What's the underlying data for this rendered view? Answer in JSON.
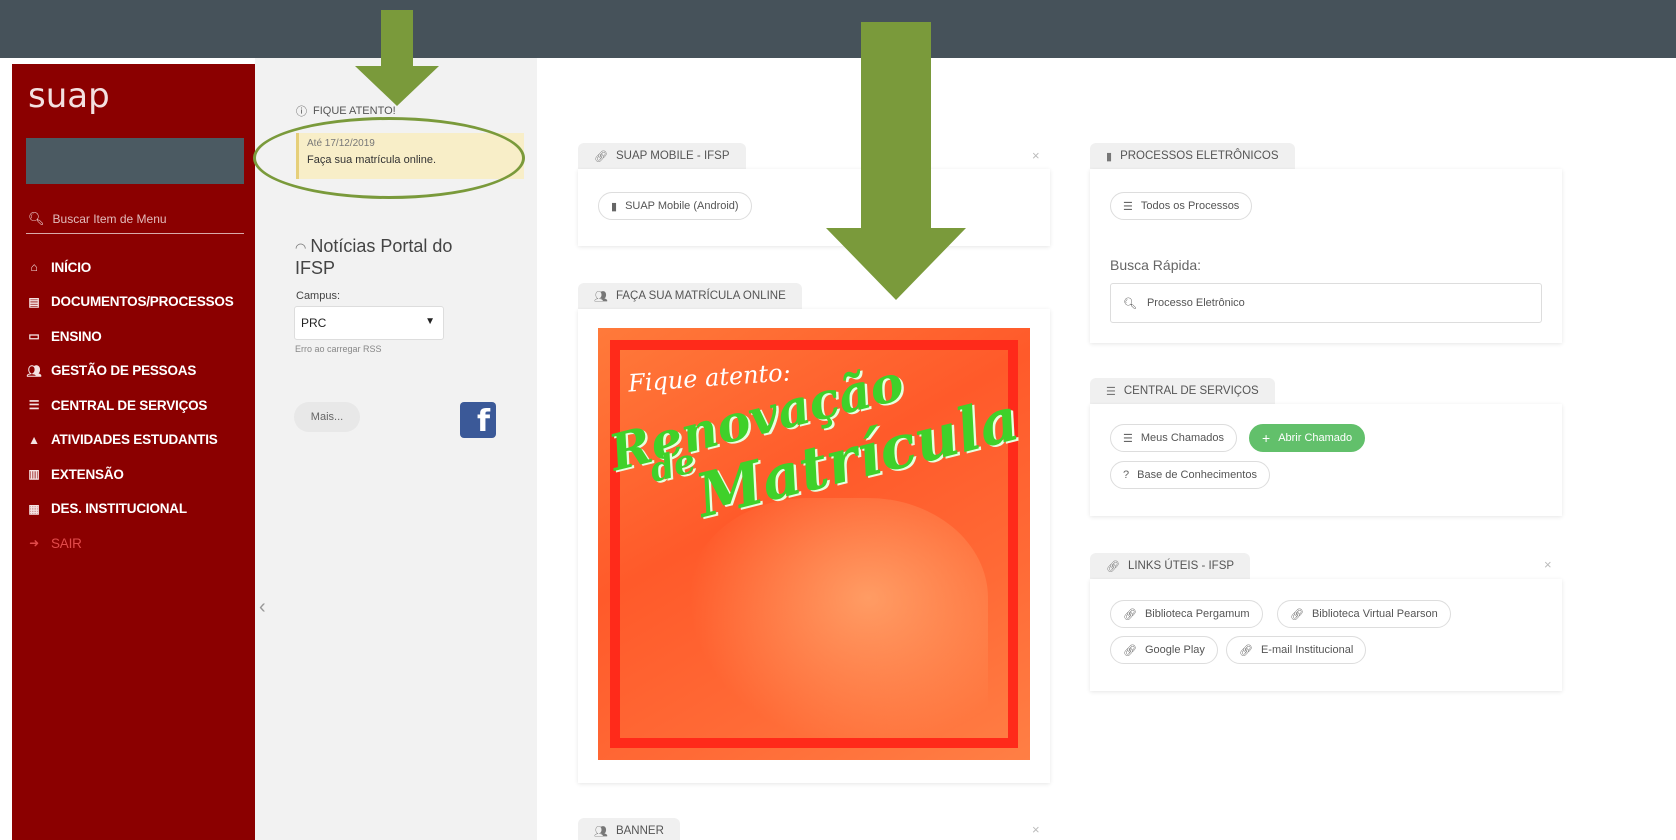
{
  "colors": {
    "topbar": "#46525a",
    "sidebar": "#8b0000",
    "arrow": "#7a9a3b",
    "success": "#62c06b",
    "notice": "#f8eec8"
  },
  "sidebar": {
    "logo": "suap",
    "search_placeholder": "Buscar Item de Menu",
    "items": [
      {
        "icon": "home-icon",
        "label": "INÍCIO"
      },
      {
        "icon": "document-icon",
        "label": "DOCUMENTOS/PROCESSOS"
      },
      {
        "icon": "teaching-icon",
        "label": "ENSINO"
      },
      {
        "icon": "people-icon",
        "label": "GESTÃO DE PESSOAS"
      },
      {
        "icon": "list-icon",
        "label": "CENTRAL DE SERVIÇOS"
      },
      {
        "icon": "graduation-cap-icon",
        "label": "ATIVIDADES ESTUDANTIS"
      },
      {
        "icon": "building-icon",
        "label": "EXTENSÃO"
      },
      {
        "icon": "chart-icon",
        "label": "DES. INSTITUCIONAL"
      },
      {
        "icon": "logout-icon",
        "label": "SAIR"
      }
    ]
  },
  "left_column": {
    "alert_title": "FIQUE ATENTO!",
    "alert_date": "Até 17/12/2019",
    "alert_message": "Faça sua matrícula online.",
    "news_title": "Notícias Portal do IFSP",
    "campus_label": "Campus:",
    "campus_value": "PRC",
    "rss_error": "Erro ao carregar RSS",
    "more_button": "Mais...",
    "facebook_glyph": "f"
  },
  "widgets": {
    "suap_mobile": {
      "title": "SUAP MOBILE - IFSP",
      "link": "SUAP Mobile (Android)"
    },
    "matricula": {
      "title": "FAÇA SUA MATRÍCULA ONLINE",
      "banner_line1": "Fique atento:",
      "banner_line2": "Renovação",
      "banner_line3": "de",
      "banner_line4": "Matrícula"
    },
    "banner": {
      "title": "BANNER"
    },
    "processos": {
      "title": "PROCESSOS ELETRÔNICOS",
      "all_button": "Todos os Processos",
      "quick_search_label": "Busca Rápida:",
      "quick_search_placeholder": "Processo Eletrônico"
    },
    "central": {
      "title": "CENTRAL DE SERVIÇOS",
      "my_calls": "Meus Chamados",
      "open_call": "Abrir Chamado",
      "knowledge_base": "Base de Conhecimentos"
    },
    "links": {
      "title": "LINKS ÚTEIS - IFSP",
      "items": [
        "Biblioteca Pergamum",
        "Biblioteca Virtual Pearson",
        "Google Play",
        "E-mail Institucional"
      ]
    },
    "close_glyph": "×"
  }
}
